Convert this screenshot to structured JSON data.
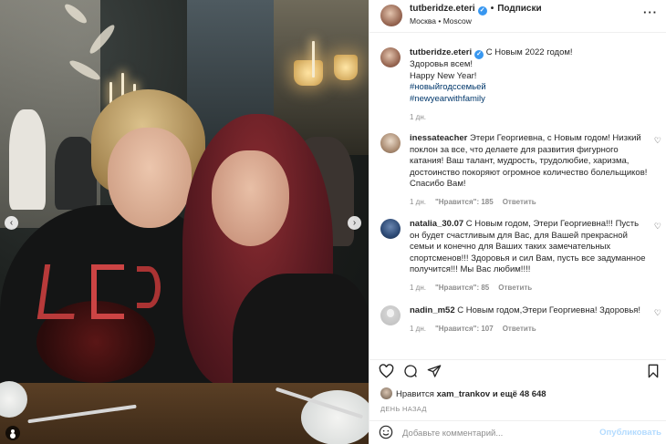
{
  "header": {
    "username": "tutberidze.eteri",
    "follow_label": "Подписки",
    "location": "Москва • Moscow",
    "separator": "•"
  },
  "caption": {
    "username": "tutberidze.eteri",
    "lines": [
      "С Новым 2022 годом!",
      "Здоровья всем!",
      "Happy New Year!"
    ],
    "hashtags": [
      "#новыйгодссемьей",
      "#newyearwithfamily"
    ],
    "time": "1 дн."
  },
  "comments": [
    {
      "username": "inessateacher",
      "text": "Этери Георгиевна, с Новым годом! Низкий поклон за все, что делаете для развития фигурного катания! Ваш талант, мудрость, трудолюбие, харизма, достоинство покоряют огромное количество болельщиков! Спасибо Вам!",
      "time": "1 дн.",
      "likes": "\"Нравится\": 185",
      "reply": "Ответить"
    },
    {
      "username": "natalia_30.07",
      "text": "С Новым годом, Этери Георгиевна!!! Пусть он будет счастливым для Вас, для Вашей прекрасной семьи и конечно для Ваших таких замечательных спортсменов!!! Здоровья и сил Вам, пусть все задуманное получится!!! Мы Вас любим!!!!",
      "time": "1 дн.",
      "likes": "\"Нравится\": 85",
      "reply": "Ответить"
    },
    {
      "username": "nadin_m52",
      "text": "С Новым годом,Этери Георгиевна! Здоровья!",
      "time": "1 дн.",
      "likes": "\"Нравится\": 107",
      "reply": "Ответить"
    }
  ],
  "likes": {
    "prefix": "Нравится",
    "user": "xam_trankov",
    "suffix": "и ещё 48 648"
  },
  "posted": "День назад",
  "composer": {
    "placeholder": "Добавьте комментарий...",
    "publish_label": "Опубликовать"
  },
  "icons": {
    "heart": "heart-icon",
    "comment": "comment-icon",
    "share": "share-icon",
    "save": "bookmark-icon",
    "emoji": "emoji-icon",
    "more": "more-icon",
    "verified": "verified-icon"
  },
  "colors": {
    "verified": "#3897f0",
    "hashtag": "#00376b",
    "muted": "#8e8e8e",
    "publish_disabled": "#b3dbff"
  }
}
